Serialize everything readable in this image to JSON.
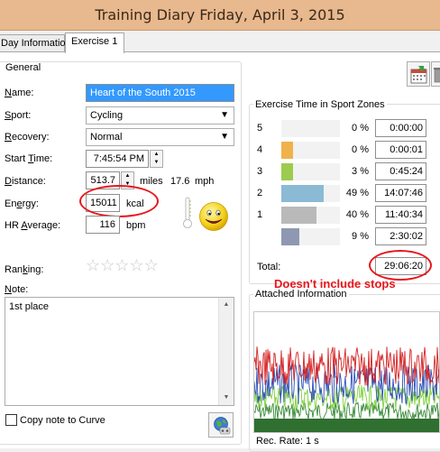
{
  "window": {
    "title": "Training Diary   Friday, April 3, 2015"
  },
  "tabs": [
    {
      "label": "Day Information"
    },
    {
      "label": "Exercise 1"
    }
  ],
  "general": {
    "section_title": "General",
    "name_label": "Name:",
    "name_value": "Heart of the South 2015",
    "sport_label": "Sport:",
    "sport_value": "Cycling",
    "recovery_label": "Recovery:",
    "recovery_value": "Normal",
    "start_time_label": "Start Time:",
    "start_time_value": "7:45:54 PM",
    "distance_label": "Distance:",
    "distance_value": "513.7",
    "distance_unit": "miles",
    "speed_value": "17.6",
    "speed_unit": "mph",
    "energy_label": "Energy:",
    "energy_value": "15011",
    "energy_unit": "kcal",
    "hr_label": "HR Average:",
    "hr_value": "116",
    "hr_unit": "bpm",
    "ranking_label": "Ranking:",
    "ranking_stars": 0,
    "note_label": "Note:",
    "note_value": "1st place",
    "copy_note_label": "Copy note to Curve"
  },
  "zones": {
    "section_title": "Exercise Time in Sport Zones",
    "rows": [
      {
        "zone": "5",
        "pct": "0 %",
        "time": "0:00:00",
        "fraction": 0.0,
        "color": "#f2f2f2"
      },
      {
        "zone": "4",
        "pct": "0 %",
        "time": "0:00:01",
        "fraction": 0.2,
        "color": "#f0b24a"
      },
      {
        "zone": "3",
        "pct": "3 %",
        "time": "0:45:24",
        "fraction": 0.2,
        "color": "#9ccb4e"
      },
      {
        "zone": "2",
        "pct": "49 %",
        "time": "14:07:46",
        "fraction": 0.72,
        "color": "#8bbad4"
      },
      {
        "zone": "1",
        "pct": "40 %",
        "time": "11:40:34",
        "fraction": 0.6,
        "color": "#b9b9b9"
      },
      {
        "zone": "",
        "pct": "9 %",
        "time": "2:30:02",
        "fraction": 0.3,
        "color": "#8f98b2"
      }
    ],
    "total_label": "Total:",
    "total_value": "29:06:20",
    "annotation": "Doesn't include stops"
  },
  "attached": {
    "section_title": "Attached Information",
    "rec_rate": "Rec. Rate: 1 s"
  },
  "colors": {
    "titlebar": "#e8b88e",
    "annotation": "#e8161d"
  },
  "icons": [
    "calendar-icon",
    "trash-icon",
    "thermometer-icon",
    "smiley-icon",
    "globe-icon"
  ]
}
